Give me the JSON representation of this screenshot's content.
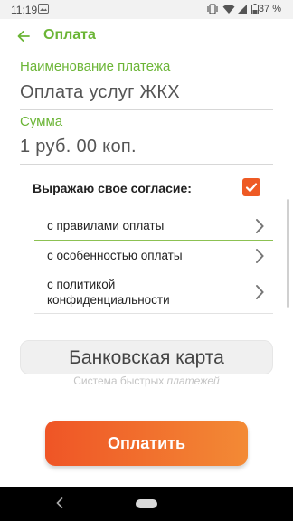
{
  "status_bar": {
    "time": "11:19",
    "notification_icon": "photo-icon",
    "icons": [
      "vibrate-icon",
      "wifi-icon",
      "signal-icon",
      "battery-icon"
    ],
    "battery": "37 %"
  },
  "app_bar": {
    "back_icon": "arrow-back-icon",
    "title": "Оплата"
  },
  "payment_name": {
    "label": "Наименование платежа",
    "value": "Оплата услуг ЖКХ"
  },
  "amount": {
    "label": "Сумма",
    "value": "1 руб. 00 коп."
  },
  "consent": {
    "title": "Выражаю свое согласие:",
    "checked": true,
    "items": [
      {
        "label": "с правилами оплаты"
      },
      {
        "label": "с особенностью оплаты"
      },
      {
        "label": "с политикой конфиденциальности"
      }
    ]
  },
  "payment_method": {
    "bank_card_label": "Банковская карта",
    "sbp_label_part1": "Система быстрых ",
    "sbp_label_part2": "платежей"
  },
  "pay_button": {
    "label": "Оплатить"
  },
  "colors": {
    "accent_green": "#6bb536",
    "accent_orange": "#ee5a24",
    "pay_gradient_end": "#f38a35"
  }
}
